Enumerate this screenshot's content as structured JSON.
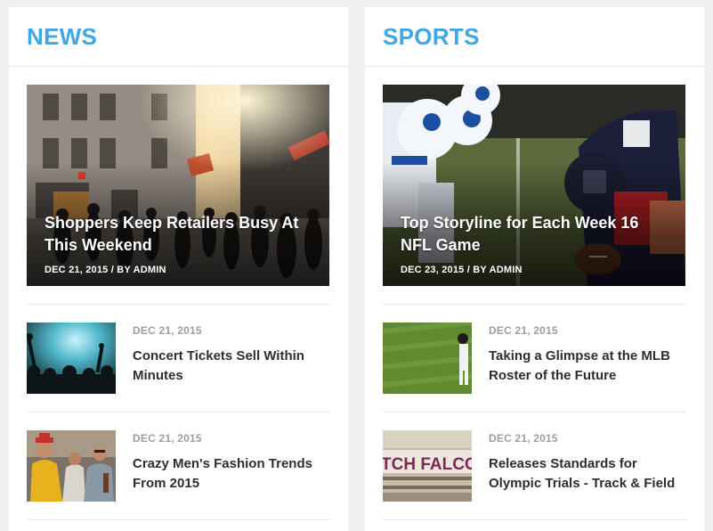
{
  "news": {
    "title": "NEWS",
    "featured": {
      "title": "Shoppers Keep Retailers Busy At This Weekend",
      "meta": "DEC 21, 2015 / BY ADMIN"
    },
    "items": [
      {
        "date": "DEC 21, 2015",
        "title": "Concert Tickets Sell Within Minutes"
      },
      {
        "date": "DEC 21, 2015",
        "title": "Crazy Men's Fashion Trends From 2015"
      }
    ]
  },
  "sports": {
    "title": "SPORTS",
    "featured": {
      "title": "Top Storyline for Each Week 16 NFL Game",
      "meta": "DEC 23, 2015 / BY ADMIN"
    },
    "items": [
      {
        "date": "DEC 21, 2015",
        "title": "Taking a Glimpse at the MLB Roster of the Future"
      },
      {
        "date": "DEC 21, 2015",
        "title": "Releases Standards for Olympic Trials - Track & Field",
        "thumb_text": "TCH FALCON"
      }
    ]
  },
  "colors": {
    "accent": "#3fa7e1",
    "title_text": "#2b2f33",
    "meta_text": "#9a9ea3"
  }
}
